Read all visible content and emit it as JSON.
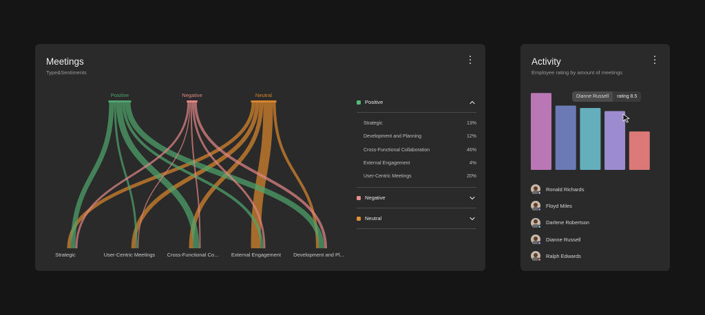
{
  "meetings": {
    "title": "Meetings",
    "subtitle": "Type&Sentiments",
    "menu_icon": "more-vertical-icon",
    "sentiments": [
      {
        "label": "Positive",
        "color": "#4fa36c"
      },
      {
        "label": "Negative",
        "color": "#e08585"
      },
      {
        "label": "Neutral",
        "color": "#d8852d"
      }
    ],
    "types": [
      "Strategic",
      "User-Centric Meetings",
      "Cross-Functional Co...",
      "External Engagement",
      "Development and Pl..."
    ],
    "legend": {
      "sections": [
        {
          "label": "Positive",
          "color": "#55b978",
          "expanded": true,
          "chevron": "chevron-up-icon",
          "rows": [
            {
              "name": "Strategic",
              "value": "13%"
            },
            {
              "name": "Development and Planning",
              "value": "12%"
            },
            {
              "name": "Cross-Functional Collaboration",
              "value": "46%"
            },
            {
              "name": "External Engagement",
              "value": "4%"
            },
            {
              "name": "User-Centric Meetings",
              "value": "20%"
            }
          ]
        },
        {
          "label": "Negative",
          "color": "#e88d8d",
          "expanded": false,
          "chevron": "chevron-down-icon"
        },
        {
          "label": "Neutral",
          "color": "#e08f3a",
          "expanded": false,
          "chevron": "chevron-down-icon"
        }
      ]
    }
  },
  "activity": {
    "title": "Activity",
    "subtitle": "Employee rating by amount of meetings",
    "menu_icon": "more-vertical-icon",
    "tooltip": {
      "name": "Dianne Russell",
      "value": "rating 8.5"
    },
    "bar_levels": [
      0.98,
      0.82,
      0.79,
      0.75,
      0.49
    ],
    "bar_colors": [
      "#b977b6",
      "#6b7ab5",
      "#65aebc",
      "#9d8bcf",
      "#db7978"
    ],
    "people": [
      {
        "name": "Ronald Richards",
        "badge": "#c6a0d8"
      },
      {
        "name": "Floyd Miles",
        "badge": "#7d8fd1"
      },
      {
        "name": "Darlene Robertson",
        "badge": "#6dc1cc"
      },
      {
        "name": "Dianne Russell",
        "badge": "#a493dc"
      },
      {
        "name": "Ralph Edwards",
        "badge": "#e08080"
      }
    ]
  }
}
